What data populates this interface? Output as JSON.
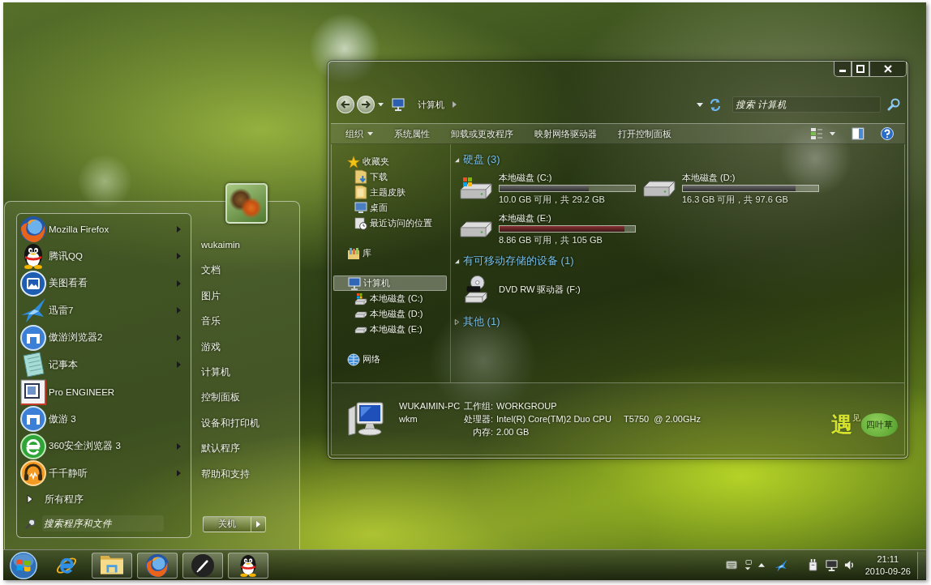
{
  "explorer": {
    "breadcrumb": [
      "计算机"
    ],
    "search": {
      "placeholder": "搜索 计算机"
    },
    "commands": [
      {
        "label": "组织",
        "dropdown": true
      },
      {
        "label": "系统属性",
        "dropdown": false
      },
      {
        "label": "卸载或更改程序",
        "dropdown": false
      },
      {
        "label": "映射网络驱动器",
        "dropdown": false
      },
      {
        "label": "打开控制面板",
        "dropdown": false
      }
    ],
    "navigation": [
      {
        "label": "收藏夹",
        "kind": "star",
        "selected": false,
        "children": [
          {
            "label": "下载",
            "kind": "download",
            "selected": false
          },
          {
            "label": "主题皮肤",
            "kind": "folder",
            "selected": false
          },
          {
            "label": "桌面",
            "kind": "desktop",
            "selected": false
          },
          {
            "label": "最近访问的位置",
            "kind": "recent",
            "selected": false
          }
        ]
      },
      {
        "label": "库",
        "kind": "library",
        "selected": false
      },
      {
        "label": "计算机",
        "kind": "computer",
        "selected": true,
        "children": [
          {
            "label": "本地磁盘 (C:)",
            "kind": "system-drive",
            "selected": false
          },
          {
            "label": "本地磁盘 (D:)",
            "kind": "drive",
            "selected": false
          },
          {
            "label": "本地磁盘 (E:)",
            "kind": "drive",
            "selected": false
          }
        ]
      },
      {
        "label": "网络",
        "kind": "network",
        "selected": false
      }
    ],
    "groups": [
      {
        "title": "硬盘 (3)",
        "expanded": true,
        "items": [
          {
            "name": "本地磁盘 (C:)",
            "kind": "system-drive",
            "level": 0.66,
            "info": "10.0 GB 可用，共 29.2 GB"
          },
          {
            "name": "本地磁盘 (D:)",
            "kind": "drive",
            "level": 0.83,
            "info": "16.3 GB 可用，共 97.6 GB"
          },
          {
            "name": "本地磁盘 (E:)",
            "kind": "drive",
            "level": 0.92,
            "info": "8.86 GB 可用，共 105 GB"
          }
        ]
      },
      {
        "title": "有可移动存储的设备 (1)",
        "expanded": true,
        "items": [
          {
            "name": "DVD RW 驱动器 (F:)",
            "kind": "dvd"
          }
        ]
      },
      {
        "title": "其他 (1)",
        "expanded": false
      }
    ],
    "details": {
      "name": "WUKAIMIN-PC",
      "description": "wkm",
      "fields": [
        {
          "label": "工作组:",
          "value": "WORKGROUP"
        },
        {
          "label": "处理器:",
          "value": "Intel(R) Core(TM)2 Duo CPU     T5750  @ 2.00GHz"
        },
        {
          "label": "内存:",
          "value": "2.00 GB"
        }
      ],
      "logo": {
        "mark": "遇",
        "small": "见",
        "label": "四叶草"
      }
    }
  },
  "start_menu": {
    "programs": [
      {
        "label": "Mozilla Firefox",
        "kind": "firefox",
        "submenu": true
      },
      {
        "label": "腾讯QQ",
        "kind": "qq",
        "submenu": true
      },
      {
        "label": "美图看看",
        "kind": "viewer",
        "submenu": true
      },
      {
        "label": "迅雷7",
        "kind": "thunder",
        "submenu": true
      },
      {
        "label": "傲游浏览器2",
        "kind": "maxthon",
        "submenu": true
      },
      {
        "label": "记事本",
        "kind": "notepad",
        "submenu": true
      },
      {
        "label": "Pro ENGINEER",
        "kind": "proe",
        "submenu": false
      },
      {
        "label": "傲游 3",
        "kind": "maxthon",
        "submenu": false
      },
      {
        "label": "360安全浏览器 3",
        "kind": "ie360",
        "submenu": true
      },
      {
        "label": "千千静听",
        "kind": "music",
        "submenu": true
      }
    ],
    "all_programs": "所有程序",
    "search": {
      "placeholder": "搜索程序和文件"
    },
    "places": [
      "wukaimin",
      "文档",
      "图片",
      "音乐",
      "游戏",
      "计算机",
      "控制面板",
      "设备和打印机",
      "默认程序",
      "帮助和支持"
    ],
    "shutdown": {
      "label": "关机"
    }
  },
  "taskbar": {
    "apps": [
      {
        "kind": "ie",
        "running": false
      },
      {
        "kind": "explorer",
        "running": true
      },
      {
        "kind": "firefox",
        "running": true
      },
      {
        "kind": "pen",
        "running": true
      },
      {
        "kind": "qq",
        "running": true
      }
    ],
    "clock": {
      "time": "21:11",
      "date": "2010-09-26"
    }
  }
}
